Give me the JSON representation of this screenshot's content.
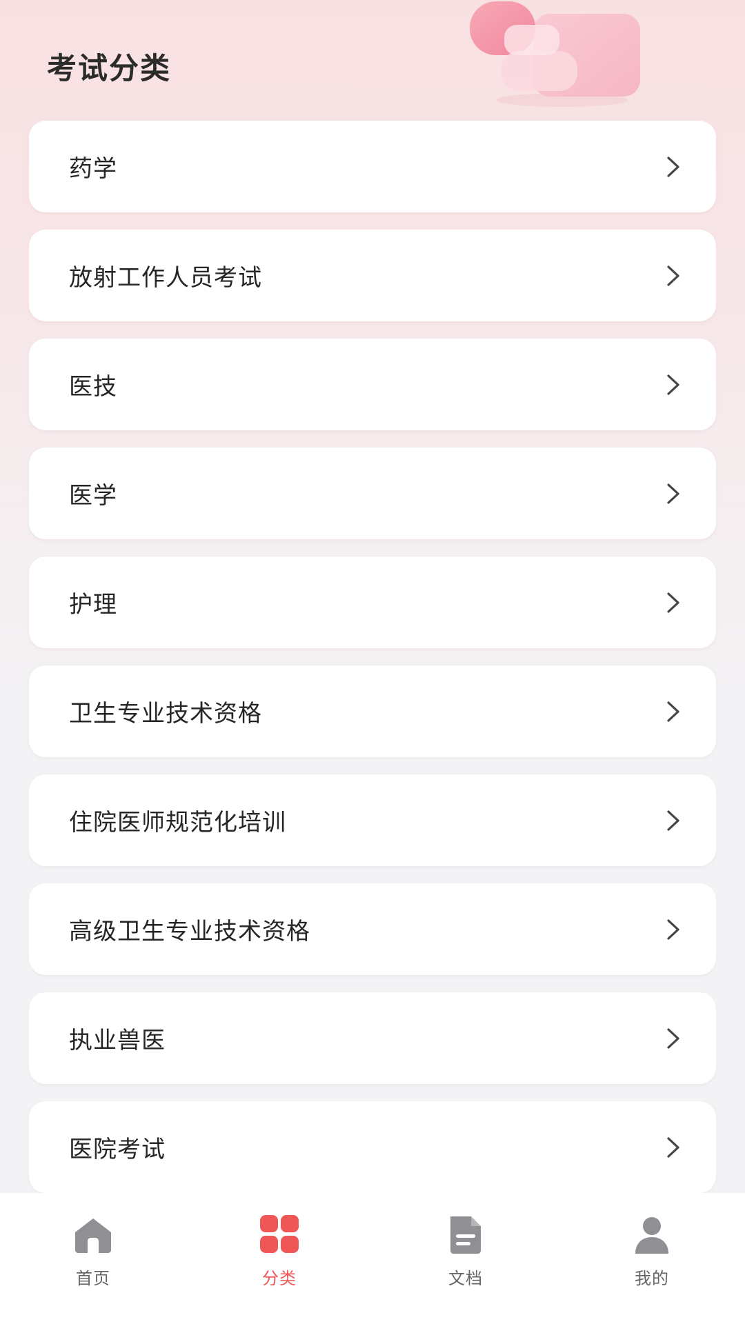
{
  "header": {
    "title": "考试分类"
  },
  "categories": [
    {
      "label": "药学",
      "icon": "chevron-right-icon"
    },
    {
      "label": "放射工作人员考试",
      "icon": "chevron-right-icon"
    },
    {
      "label": "医技",
      "icon": "chevron-right-icon"
    },
    {
      "label": "医学",
      "icon": "chevron-right-icon"
    },
    {
      "label": "护理",
      "icon": "chevron-right-icon"
    },
    {
      "label": "卫生专业技术资格",
      "icon": "chevron-right-icon"
    },
    {
      "label": "住院医师规范化培训",
      "icon": "chevron-right-icon"
    },
    {
      "label": "高级卫生专业技术资格",
      "icon": "chevron-right-icon"
    },
    {
      "label": "执业兽医",
      "icon": "chevron-right-icon"
    },
    {
      "label": "医院考试",
      "icon": "chevron-right-icon"
    }
  ],
  "tabbar": {
    "items": [
      {
        "label": "首页",
        "icon": "home-icon",
        "active": false
      },
      {
        "label": "分类",
        "icon": "category-grid-icon",
        "active": true
      },
      {
        "label": "文档",
        "icon": "document-icon",
        "active": false
      },
      {
        "label": "我的",
        "icon": "user-icon",
        "active": false
      }
    ],
    "active_color": "#ef5656",
    "inactive_color": "#8f8f94"
  },
  "theme": {
    "accent": "#ef5656",
    "hero_gradient_top": "#f9e1e2",
    "page_background": "#f3f3f6",
    "card_background": "#ffffff"
  }
}
